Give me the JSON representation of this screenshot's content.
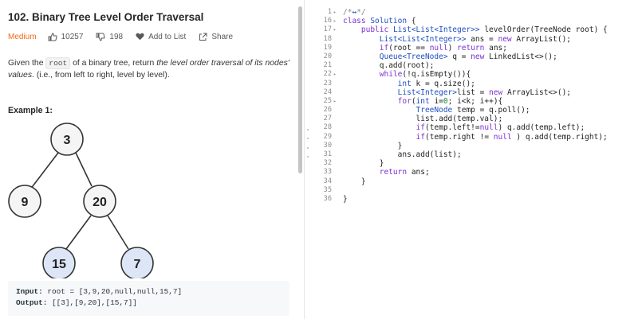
{
  "problem": {
    "title": "102. Binary Tree Level Order Traversal",
    "difficulty": "Medium",
    "likes": "10257",
    "dislikes": "198",
    "add_to_list": "Add to List",
    "share": "Share",
    "description": {
      "part1": "Given the ",
      "code": "root",
      "part2": " of a binary tree, return ",
      "emph": "the level order traversal of its nodes' values",
      "part3": ". (i.e., from left to right, level by level)."
    },
    "example_title": "Example 1:",
    "tree_nodes": [
      "3",
      "9",
      "20",
      "15",
      "7"
    ],
    "input_label": "Input:",
    "input_value": " root = [3,9,20,null,null,15,7]",
    "output_label": "Output:",
    "output_value": " [[3],[9,20],[15,7]]"
  },
  "colors": {
    "difficulty": "#ef6c1a",
    "leaf_node_fill": "#dde6f6",
    "node_fill": "#f5f5f5",
    "keyword": "#7b30d0",
    "type": "#1f4fbf"
  },
  "code": {
    "lines": [
      {
        "n": "1",
        "fold": true,
        "segs": [
          {
            "t": "/*",
            "c": "cm"
          },
          {
            "t": "↔",
            "c": "ty"
          },
          {
            "t": "*/",
            "c": "cm"
          }
        ]
      },
      {
        "n": "16",
        "fold": true,
        "segs": [
          {
            "t": "class ",
            "c": "kw"
          },
          {
            "t": "Solution",
            "c": "ty"
          },
          {
            "t": " {",
            "c": ""
          }
        ]
      },
      {
        "n": "17",
        "fold": true,
        "segs": [
          {
            "t": "    ",
            "c": ""
          },
          {
            "t": "public ",
            "c": "kw"
          },
          {
            "t": "List<List<Integer>> ",
            "c": "ty"
          },
          {
            "t": "levelOrder(TreeNode root) {",
            "c": ""
          }
        ]
      },
      {
        "n": "18",
        "fold": false,
        "segs": [
          {
            "t": "        ",
            "c": ""
          },
          {
            "t": "List<List<Integer>> ",
            "c": "ty"
          },
          {
            "t": "ans = ",
            "c": ""
          },
          {
            "t": "new ",
            "c": "kw"
          },
          {
            "t": "ArrayList();",
            "c": ""
          }
        ]
      },
      {
        "n": "19",
        "fold": false,
        "segs": [
          {
            "t": "        ",
            "c": ""
          },
          {
            "t": "if",
            "c": "kw"
          },
          {
            "t": "(root == ",
            "c": ""
          },
          {
            "t": "null",
            "c": "kw"
          },
          {
            "t": ") ",
            "c": ""
          },
          {
            "t": "return ",
            "c": "kw"
          },
          {
            "t": "ans;",
            "c": ""
          }
        ]
      },
      {
        "n": "20",
        "fold": false,
        "segs": [
          {
            "t": "        ",
            "c": ""
          },
          {
            "t": "Queue<TreeNode> ",
            "c": "ty"
          },
          {
            "t": "q = ",
            "c": ""
          },
          {
            "t": "new ",
            "c": "kw"
          },
          {
            "t": "LinkedList<>();",
            "c": ""
          }
        ]
      },
      {
        "n": "21",
        "fold": false,
        "segs": [
          {
            "t": "        q.add(root);",
            "c": ""
          }
        ]
      },
      {
        "n": "22",
        "fold": true,
        "segs": [
          {
            "t": "        ",
            "c": ""
          },
          {
            "t": "while",
            "c": "kw"
          },
          {
            "t": "(!q.isEmpty()){",
            "c": ""
          }
        ]
      },
      {
        "n": "23",
        "fold": false,
        "segs": [
          {
            "t": "            ",
            "c": ""
          },
          {
            "t": "int ",
            "c": "ty"
          },
          {
            "t": "k = q.size();",
            "c": ""
          }
        ]
      },
      {
        "n": "24",
        "fold": false,
        "segs": [
          {
            "t": "            ",
            "c": ""
          },
          {
            "t": "List<Integer>",
            "c": "ty"
          },
          {
            "t": "list = ",
            "c": ""
          },
          {
            "t": "new ",
            "c": "kw"
          },
          {
            "t": "ArrayList<>();",
            "c": ""
          }
        ]
      },
      {
        "n": "25",
        "fold": true,
        "segs": [
          {
            "t": "            ",
            "c": ""
          },
          {
            "t": "for",
            "c": "kw"
          },
          {
            "t": "(",
            "c": ""
          },
          {
            "t": "int ",
            "c": "ty"
          },
          {
            "t": "i=",
            "c": ""
          },
          {
            "t": "0",
            "c": "nu"
          },
          {
            "t": "; i<k; i++){",
            "c": ""
          }
        ]
      },
      {
        "n": "26",
        "fold": false,
        "segs": [
          {
            "t": "                ",
            "c": ""
          },
          {
            "t": "TreeNode ",
            "c": "ty"
          },
          {
            "t": "temp = q.poll();",
            "c": ""
          }
        ]
      },
      {
        "n": "27",
        "fold": false,
        "segs": [
          {
            "t": "                list.add(temp.val);",
            "c": ""
          }
        ]
      },
      {
        "n": "28",
        "fold": false,
        "segs": [
          {
            "t": "                ",
            "c": ""
          },
          {
            "t": "if",
            "c": "kw"
          },
          {
            "t": "(temp.left!=",
            "c": ""
          },
          {
            "t": "null",
            "c": "kw"
          },
          {
            "t": ") q.add(temp.left);",
            "c": ""
          }
        ]
      },
      {
        "n": "29",
        "fold": false,
        "segs": [
          {
            "t": "                ",
            "c": ""
          },
          {
            "t": "if",
            "c": "kw"
          },
          {
            "t": "(temp.right != ",
            "c": ""
          },
          {
            "t": "null",
            "c": "kw"
          },
          {
            "t": " ) q.add(temp.right);",
            "c": ""
          }
        ]
      },
      {
        "n": "30",
        "fold": false,
        "segs": [
          {
            "t": "            }",
            "c": ""
          }
        ]
      },
      {
        "n": "31",
        "fold": false,
        "segs": [
          {
            "t": "            ans.add(list);",
            "c": ""
          }
        ]
      },
      {
        "n": "32",
        "fold": false,
        "segs": [
          {
            "t": "        }",
            "c": ""
          }
        ]
      },
      {
        "n": "33",
        "fold": false,
        "segs": [
          {
            "t": "        ",
            "c": ""
          },
          {
            "t": "return ",
            "c": "kw"
          },
          {
            "t": "ans;",
            "c": ""
          }
        ]
      },
      {
        "n": "34",
        "fold": false,
        "segs": [
          {
            "t": "    }",
            "c": ""
          }
        ]
      },
      {
        "n": "35",
        "fold": false,
        "segs": []
      },
      {
        "n": "36",
        "fold": false,
        "segs": [
          {
            "t": "}",
            "c": ""
          }
        ]
      }
    ]
  }
}
